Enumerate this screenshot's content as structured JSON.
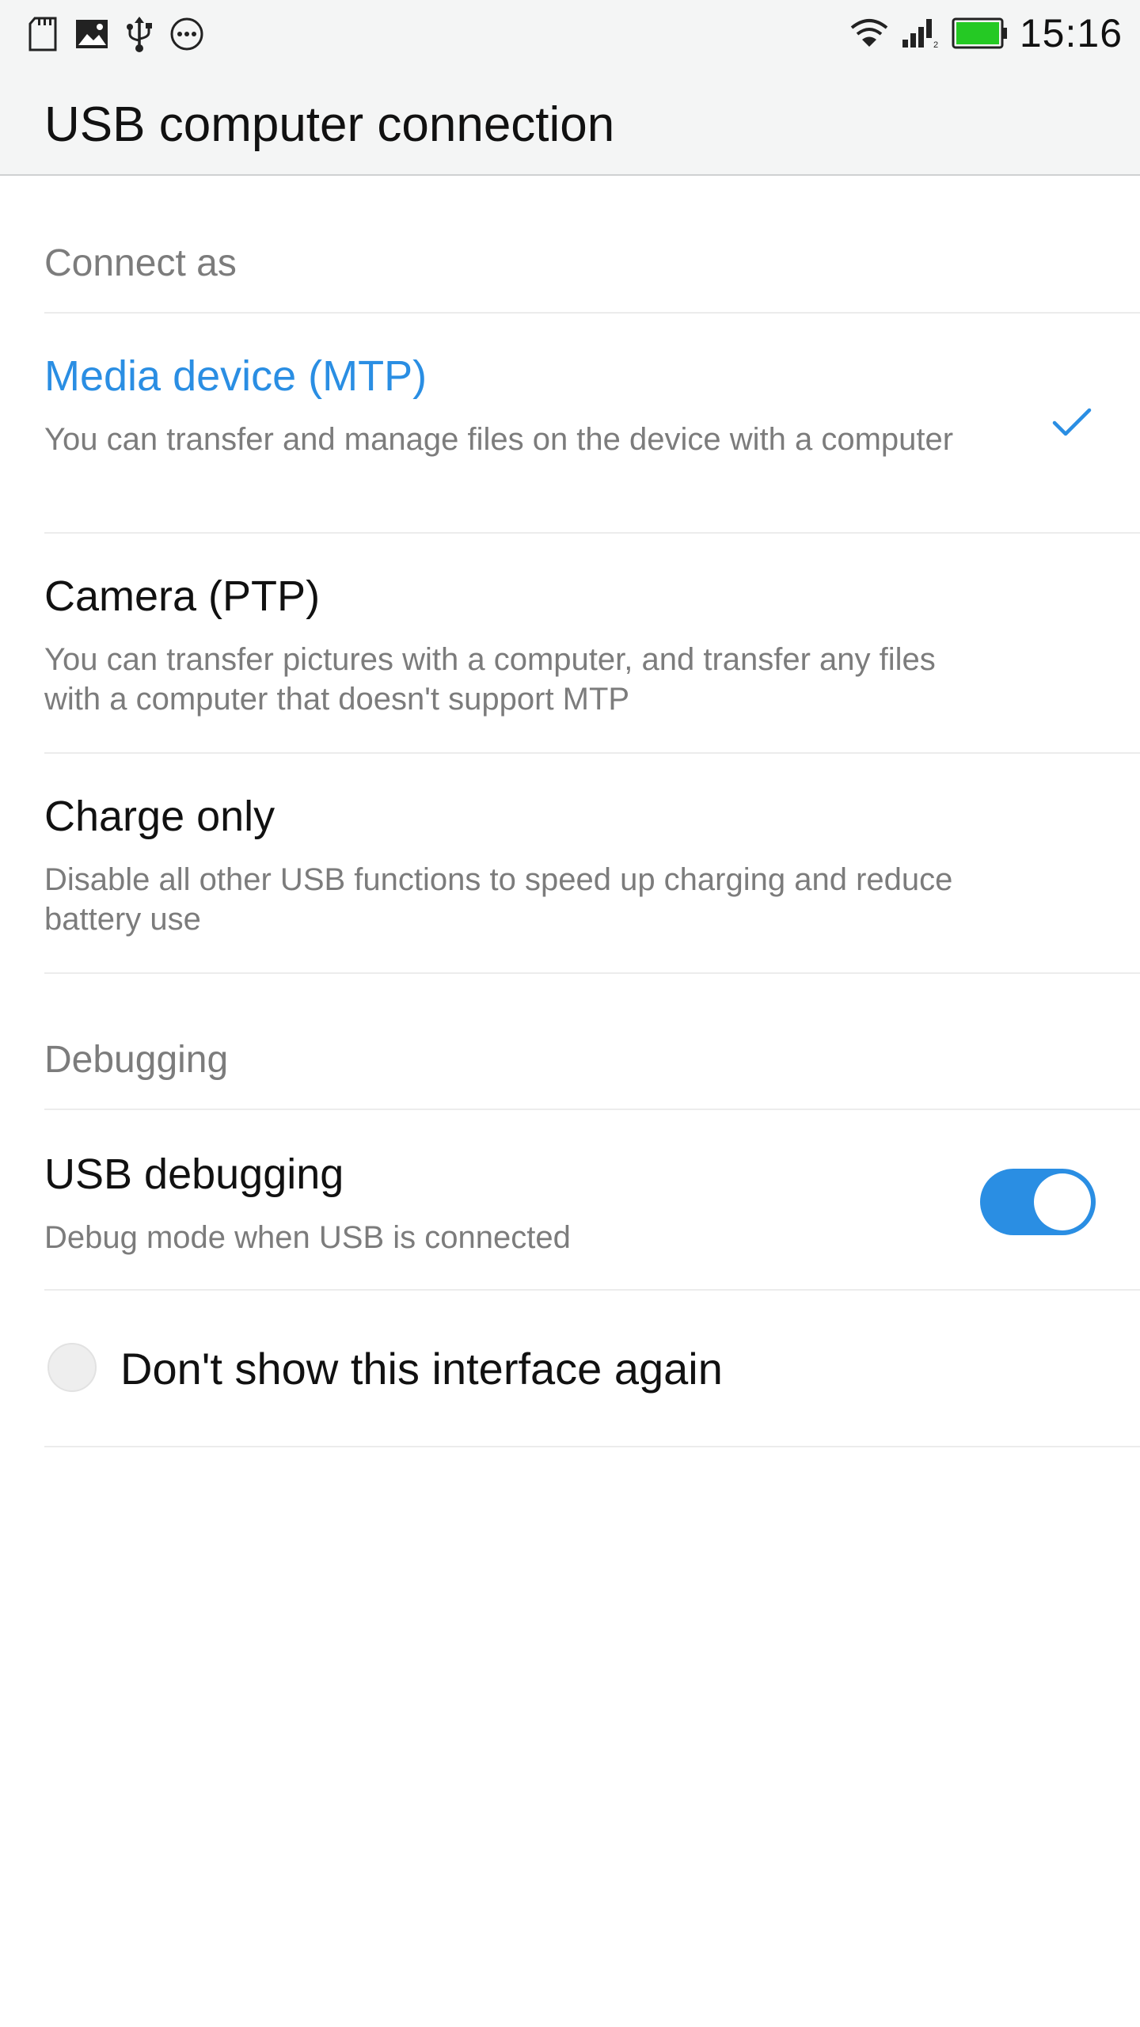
{
  "status_bar": {
    "time": "15:16",
    "left_icons": [
      "sd-card-icon",
      "image-icon",
      "usb-icon",
      "more-circle-icon"
    ],
    "right_icons": [
      "wifi-icon",
      "signal-icon",
      "battery-icon"
    ]
  },
  "app_bar": {
    "title": "USB computer connection"
  },
  "connect_section": {
    "header": "Connect as",
    "options": [
      {
        "title": "Media device (MTP)",
        "description": "You can transfer and manage files on the device with a computer",
        "selected": true
      },
      {
        "title": "Camera (PTP)",
        "description": "You can transfer pictures with a computer, and transfer any files with a computer that doesn't support MTP",
        "selected": false
      },
      {
        "title": "Charge only",
        "description": "Disable all other USB functions to speed up charging and reduce battery use",
        "selected": false
      }
    ]
  },
  "debugging_section": {
    "header": "Debugging",
    "usb_debugging": {
      "title": "USB debugging",
      "description": "Debug mode when USB is connected",
      "enabled": true
    }
  },
  "dont_show": {
    "label": "Don't show this interface again",
    "checked": false
  },
  "colors": {
    "accent": "#2a8ee3",
    "toolbar_bg": "#f4f5f5",
    "secondary_text": "#7c7c7c"
  }
}
